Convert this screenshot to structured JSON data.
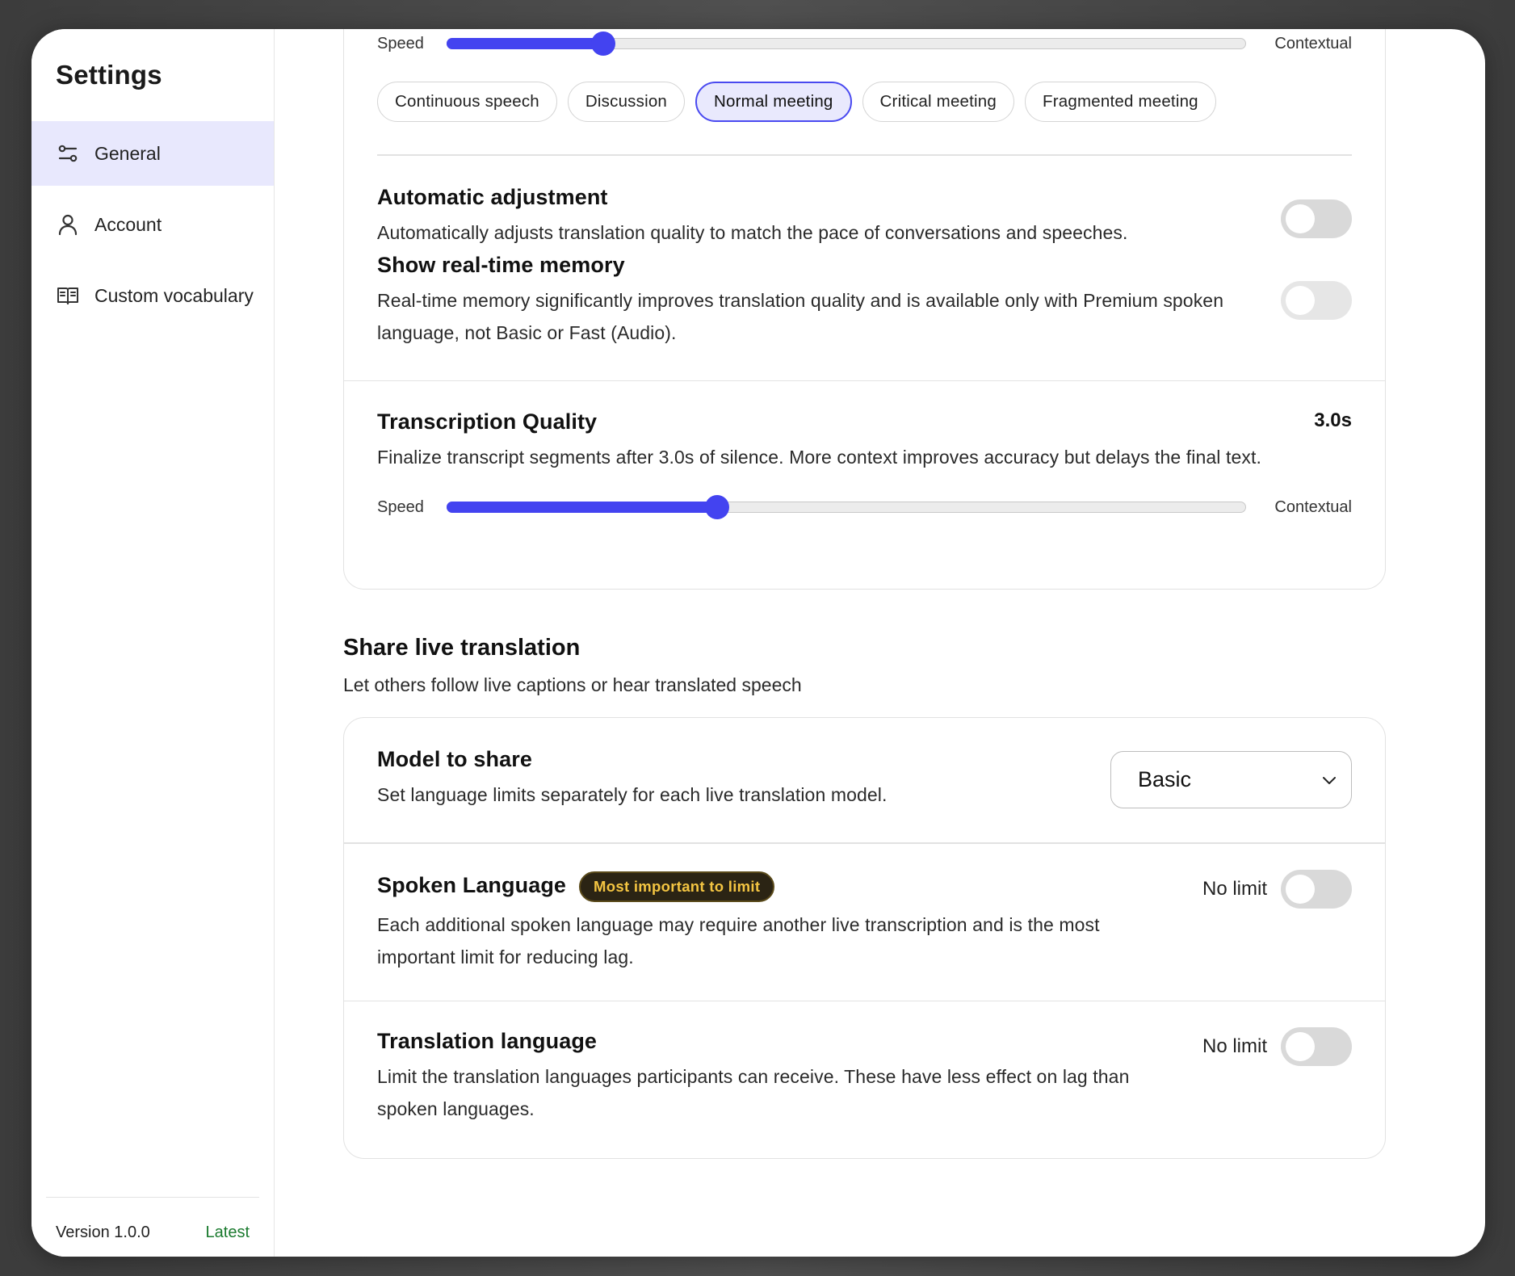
{
  "sidebar": {
    "title": "Settings",
    "items": [
      {
        "label": "General",
        "icon": "sliders-icon",
        "active": true
      },
      {
        "label": "Account",
        "icon": "user-icon",
        "active": false
      },
      {
        "label": "Custom vocabulary",
        "icon": "book-icon",
        "active": false
      }
    ],
    "footer": {
      "version": "Version 1.0.0",
      "status": "Latest"
    }
  },
  "translation_quality_top": {
    "slider": {
      "left_label": "Speed",
      "right_label": "Contextual",
      "value_fraction": 0.195
    },
    "presets": [
      {
        "label": "Continuous speech",
        "active": false
      },
      {
        "label": "Discussion",
        "active": false
      },
      {
        "label": "Normal meeting",
        "active": true
      },
      {
        "label": "Critical meeting",
        "active": false
      },
      {
        "label": "Fragmented meeting",
        "active": false
      }
    ]
  },
  "automatic_adjustment": {
    "title": "Automatic adjustment",
    "description": "Automatically adjusts translation quality to match the pace of conversations and speeches.",
    "enabled": false
  },
  "realtime_memory": {
    "title": "Show real-time memory",
    "description": "Real-time memory significantly improves translation quality and is available only with Premium spoken language, not Basic or Fast (Audio).",
    "enabled": false
  },
  "transcription_quality": {
    "title": "Transcription Quality",
    "value": "3.0s",
    "description": "Finalize transcript segments after 3.0s of silence. More context improves accuracy but delays the final text.",
    "slider": {
      "left_label": "Speed",
      "right_label": "Contextual",
      "value_fraction": 0.338
    }
  },
  "share": {
    "heading": "Share live translation",
    "subheading": "Let others follow live captions or hear translated speech",
    "model": {
      "title": "Model to share",
      "description": "Set language limits separately for each live translation model.",
      "selected": "Basic"
    },
    "spoken_language": {
      "title": "Spoken Language",
      "badge": "Most important to limit",
      "description": "Each additional spoken language may require another live transcription and is the most important limit for reducing lag.",
      "limit_label": "No limit",
      "enabled": false
    },
    "translation_language": {
      "title": "Translation language",
      "description": "Limit the translation languages participants can receive. These have less effect on lag than spoken languages.",
      "limit_label": "No limit",
      "enabled": false
    }
  },
  "colors": {
    "accent": "#4343f0",
    "badge_text": "#f4c542",
    "latest": "#1a7a2e"
  }
}
